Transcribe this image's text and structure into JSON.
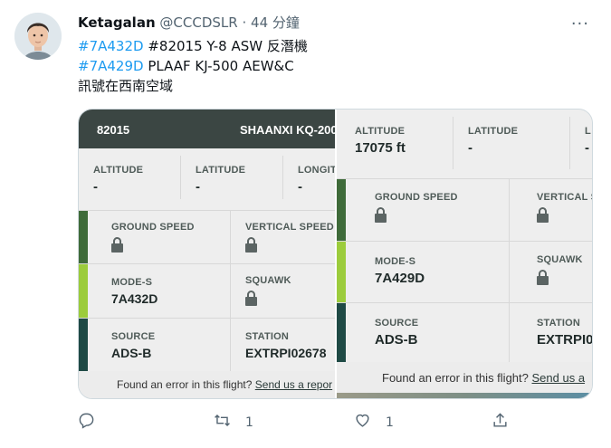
{
  "tweet": {
    "author_name": "Ketagalan",
    "handle": "@CCCDSLR",
    "separator": "·",
    "time": "44 分鐘",
    "more": "···",
    "lines": [
      {
        "tag": "#7A432D",
        "text": " #82015 Y-8 ASW 反潛機"
      },
      {
        "tag": "#7A429D",
        "text": " PLAAF KJ-500 AEW&C"
      },
      {
        "tag": "",
        "text": "訊號在西南空域"
      }
    ],
    "colors": {
      "link": "#1d9bf0",
      "text": "#0f1419",
      "muted": "#536471"
    }
  },
  "left_card": {
    "callsign": "82015",
    "aircraft": "SHAANXI KQ-200",
    "altitude_label": "ALTITUDE",
    "altitude_value": "-",
    "latitude_label": "LATITUDE",
    "latitude_value": "-",
    "longitude_label": "LONGITU",
    "longitude_value": "-",
    "ground_speed_label": "GROUND SPEED",
    "vertical_speed_label": "VERTICAL SPEED",
    "modes_label": "MODE-S",
    "modes_value": "7A432D",
    "squawk_label": "SQUAWK",
    "source_label": "SOURCE",
    "source_value": "ADS-B",
    "station_label": "STATION",
    "station_value": "EXTRPI02678",
    "footer_text": "Found an error in this flight?",
    "footer_link": "Send us a repor"
  },
  "right_card": {
    "altitude_label": "ALTITUDE",
    "altitude_value": "17075 ft",
    "latitude_label": "LATITUDE",
    "latitude_value": "-",
    "longitude_label": "L",
    "longitude_value": "-",
    "ground_speed_label": "GROUND SPEED",
    "vertical_speed_label": "VERTICAL S",
    "modes_label": "MODE-S",
    "modes_value": "7A429D",
    "squawk_label": "SQUAWK",
    "source_label": "SOURCE",
    "source_value": "ADS-B",
    "station_label": "STATION",
    "station_value": "EXTRPI0",
    "footer_text": "Found an error in this flight?",
    "footer_link": "Send us a"
  },
  "strip_colors": {
    "dark_green": "#3f6b3a",
    "lime": "#9ccc3c",
    "teal": "#1f4a45"
  },
  "actions": {
    "reply_icon": "reply-icon",
    "retweet_icon": "retweet-icon",
    "retweet_count": "1",
    "like_icon": "heart-icon",
    "like_count": "1",
    "share_icon": "share-icon"
  }
}
